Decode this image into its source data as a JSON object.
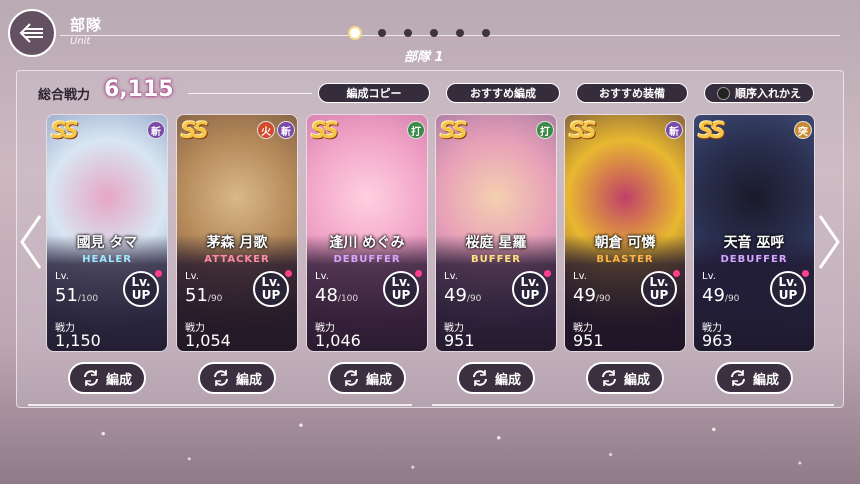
{
  "header": {
    "title": "部隊",
    "subtitle": "Unit",
    "unit_label": "部隊 1",
    "page_dots": 6,
    "active_page": 0
  },
  "power": {
    "label": "総合戦力",
    "value": "6,115"
  },
  "buttons": {
    "copy": "編成コピー",
    "recommend_team": "おすすめ編成",
    "recommend_equip": "おすすめ装備",
    "reorder": "順序入れかえ",
    "edit": "編成"
  },
  "lv_label": "Lv.",
  "lvup_label": {
    "line1": "Lv.",
    "line2": "UP"
  },
  "power_label": "戦力",
  "rank_label": "SS",
  "cards": [
    {
      "name": "國見 タマ",
      "role": "HEALER",
      "role_color": "#9fe6ff",
      "lv": "51",
      "max": "/100",
      "power": "1,150",
      "attrs": [
        {
          "t": "斬",
          "c": "#7b4aa8"
        }
      ],
      "art": [
        "#d8e6f2",
        "#7b8bb8",
        "#e6a6c6"
      ]
    },
    {
      "name": "茅森 月歌",
      "role": "ATTACKER",
      "role_color": "#ff8aa8",
      "lv": "51",
      "max": "/90",
      "power": "1,054",
      "attrs": [
        {
          "t": "火",
          "c": "#d04b2a"
        },
        {
          "t": "斬",
          "c": "#7b4aa8"
        }
      ],
      "art": [
        "#b58a5a",
        "#6a4a3a",
        "#d9b88a"
      ]
    },
    {
      "name": "逢川 めぐみ",
      "role": "DEBUFFER",
      "role_color": "#d6a6ff",
      "lv": "48",
      "max": "/100",
      "power": "1,046",
      "attrs": [
        {
          "t": "打",
          "c": "#3c8a4a"
        }
      ],
      "art": [
        "#f2a6c8",
        "#c86aa0",
        "#ffd0e0"
      ]
    },
    {
      "name": "桜庭 星羅",
      "role": "BUFFER",
      "role_color": "#ffe27a",
      "lv": "49",
      "max": "/90",
      "power": "951",
      "attrs": [
        {
          "t": "打",
          "c": "#3c8a4a"
        }
      ],
      "art": [
        "#e8a0b8",
        "#8a6a9a",
        "#f4d0b0"
      ]
    },
    {
      "name": "朝倉 可憐",
      "role": "BLASTER",
      "role_color": "#ffb347",
      "lv": "49",
      "max": "/90",
      "power": "951",
      "attrs": [
        {
          "t": "斬",
          "c": "#7b4aa8"
        }
      ],
      "art": [
        "#e8b830",
        "#4a3040",
        "#c0406a"
      ]
    },
    {
      "name": "天音 巫呼",
      "role": "DEBUFFER",
      "role_color": "#d6a6ff",
      "lv": "49",
      "max": "/90",
      "power": "963",
      "attrs": [
        {
          "t": "突",
          "c": "#c88a30"
        }
      ],
      "art": [
        "#2a3050",
        "#4a5a8a",
        "#1a1a2a"
      ]
    }
  ]
}
